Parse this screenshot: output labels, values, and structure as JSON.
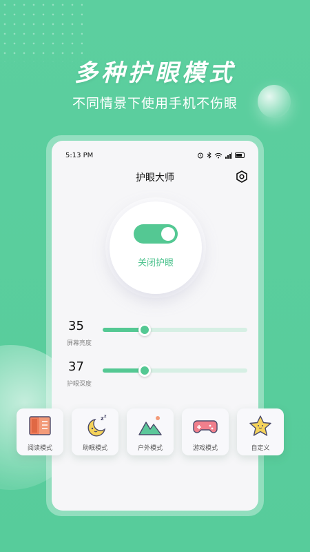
{
  "promo": {
    "headline": "多种护眼模式",
    "subline": "不同情景下使用手机不伤眼"
  },
  "status_bar": {
    "time": "5:13 PM",
    "icons": [
      "alarm-icon",
      "bluetooth-icon",
      "wifi-icon",
      "signal-icon",
      "battery-icon"
    ]
  },
  "app": {
    "title": "护眼大师",
    "settings_icon": "settings-hexagon-icon"
  },
  "eye_protection": {
    "toggle_on": true,
    "toggle_label": "关闭护眼"
  },
  "sliders": [
    {
      "value": "35",
      "label": "屏幕亮度",
      "level": 0.29
    },
    {
      "value": "37",
      "label": "护眼深度",
      "level": 0.29
    }
  ],
  "modes": [
    {
      "label": "阅读模式",
      "icon": "book-icon"
    },
    {
      "label": "助眠模式",
      "icon": "moon-sleep-icon"
    },
    {
      "label": "户外模式",
      "icon": "mountain-sun-icon"
    },
    {
      "label": "游戏模式",
      "icon": "gamepad-icon"
    },
    {
      "label": "自定义",
      "icon": "star-icon"
    }
  ],
  "colors": {
    "background": "#5ccf9f",
    "accent": "#54c893",
    "screen": "#f6f6f8"
  }
}
